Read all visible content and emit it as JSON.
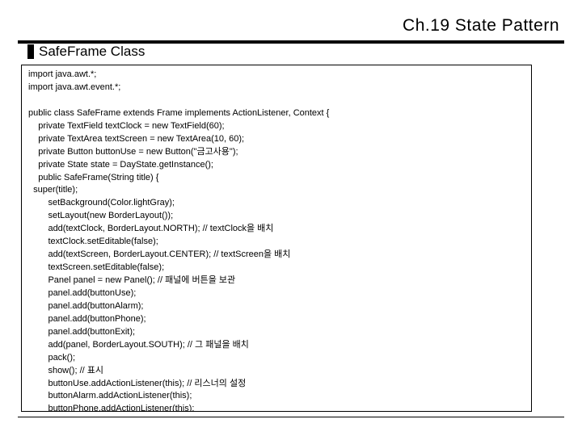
{
  "chapter": "Ch.19 State Pattern",
  "section_title": "SafeFrame Class",
  "code": "import java.awt.*;\nimport java.awt.event.*;\n\npublic class SafeFrame extends Frame implements ActionListener, Context {\n    private TextField textClock = new TextField(60);\n    private TextArea textScreen = new TextArea(10, 60);\n    private Button buttonUse = new Button(\"금고사용\");\n    private State state = DayState.getInstance();\n    public SafeFrame(String title) {\n  super(title);\n        setBackground(Color.lightGray);\n        setLayout(new BorderLayout());\n        add(textClock, BorderLayout.NORTH); // textClock을 배치\n        textClock.setEditable(false);\n        add(textScreen, BorderLayout.CENTER); // textScreen을 배치\n        textScreen.setEditable(false);\n        Panel panel = new Panel(); // 패널에 버튼을 보관\n        panel.add(buttonUse);\n        panel.add(buttonAlarm);\n        panel.add(buttonPhone);\n        panel.add(buttonExit);\n        add(panel, BorderLayout.SOUTH); // 그 패널을 배치\n        pack();\n        show(); // 표시\n        buttonUse.addActionListener(this); // 리스너의 설정\n        buttonAlarm.addActionListener(this);\n        buttonPhone.addActionListener(this);\n        buttonExit.addActionListener(this);\n    }"
}
